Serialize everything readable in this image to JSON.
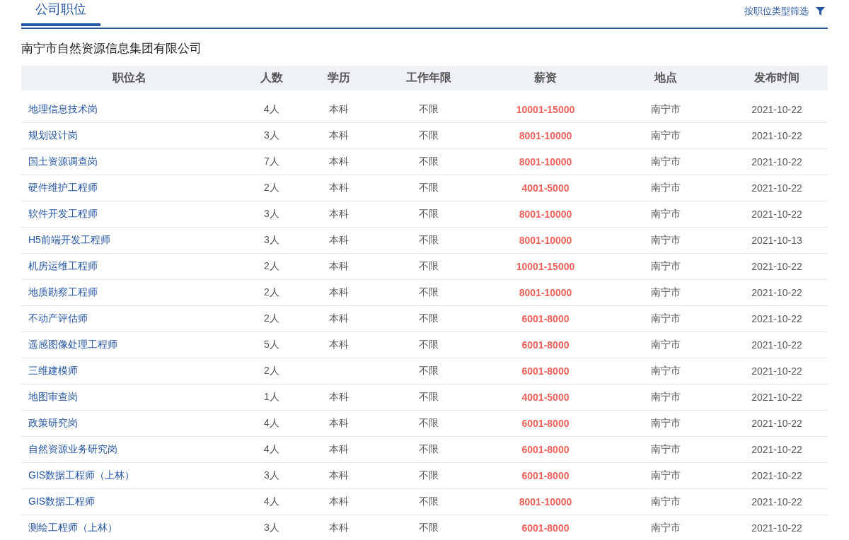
{
  "tabs": [
    {
      "label": "公司职位",
      "selected": true
    }
  ],
  "filter": {
    "label": "按职位类型筛选"
  },
  "company": "南宁市自然资源信息集团有限公司",
  "table": {
    "columns": [
      "职位名",
      "人数",
      "学历",
      "工作年限",
      "薪资",
      "地点",
      "发布时间"
    ],
    "rows": [
      {
        "name": "地理信息技术岗",
        "count": "4人",
        "education": "本科",
        "experience": "不限",
        "salary": "10001-15000",
        "location": "南宁市",
        "date": "2021-10-22"
      },
      {
        "name": "规划设计岗",
        "count": "3人",
        "education": "本科",
        "experience": "不限",
        "salary": "8001-10000",
        "location": "南宁市",
        "date": "2021-10-22"
      },
      {
        "name": "国土资源调查岗",
        "count": "7人",
        "education": "本科",
        "experience": "不限",
        "salary": "8001-10000",
        "location": "南宁市",
        "date": "2021-10-22"
      },
      {
        "name": "硬件维护工程师",
        "count": "2人",
        "education": "本科",
        "experience": "不限",
        "salary": "4001-5000",
        "location": "南宁市",
        "date": "2021-10-22"
      },
      {
        "name": "软件开发工程师",
        "count": "3人",
        "education": "本科",
        "experience": "不限",
        "salary": "8001-10000",
        "location": "南宁市",
        "date": "2021-10-22"
      },
      {
        "name": "H5前端开发工程师",
        "count": "3人",
        "education": "本科",
        "experience": "不限",
        "salary": "8001-10000",
        "location": "南宁市",
        "date": "2021-10-13"
      },
      {
        "name": "机房运维工程师",
        "count": "2人",
        "education": "本科",
        "experience": "不限",
        "salary": "10001-15000",
        "location": "南宁市",
        "date": "2021-10-22"
      },
      {
        "name": "地质勘察工程师",
        "count": "2人",
        "education": "本科",
        "experience": "不限",
        "salary": "8001-10000",
        "location": "南宁市",
        "date": "2021-10-22"
      },
      {
        "name": "不动产评估师",
        "count": "2人",
        "education": "本科",
        "experience": "不限",
        "salary": "6001-8000",
        "location": "南宁市",
        "date": "2021-10-22"
      },
      {
        "name": "遥感图像处理工程师",
        "count": "5人",
        "education": "本科",
        "experience": "不限",
        "salary": "6001-8000",
        "location": "南宁市",
        "date": "2021-10-22"
      },
      {
        "name": "三维建模师",
        "count": "2人",
        "experience": "不限",
        "salary": "6001-8000",
        "location": "南宁市",
        "date": "2021-10-22"
      },
      {
        "name": "地图审查岗",
        "count": "1人",
        "education": "本科",
        "experience": "不限",
        "salary": "4001-5000",
        "location": "南宁市",
        "date": "2021-10-22"
      },
      {
        "name": "政策研究岗",
        "count": "4人",
        "education": "本科",
        "experience": "不限",
        "salary": "6001-8000",
        "location": "南宁市",
        "date": "2021-10-22"
      },
      {
        "name": "自然资源业务研究岗",
        "count": "4人",
        "education": "本科",
        "experience": "不限",
        "salary": "6001-8000",
        "location": "南宁市",
        "date": "2021-10-22"
      },
      {
        "name": "GIS数据工程师（上林）",
        "count": "3人",
        "education": "本科",
        "experience": "不限",
        "salary": "6001-8000",
        "location": "南宁市",
        "date": "2021-10-22"
      },
      {
        "name": "GIS数据工程师",
        "count": "4人",
        "education": "本科",
        "experience": "不限",
        "salary": "8001-10000",
        "location": "南宁市",
        "date": "2021-10-22"
      },
      {
        "name": "测绘工程师（上林）",
        "count": "3人",
        "education": "本科",
        "experience": "不限",
        "salary": "6001-8000",
        "location": "南宁市",
        "date": "2021-10-22"
      }
    ]
  }
}
